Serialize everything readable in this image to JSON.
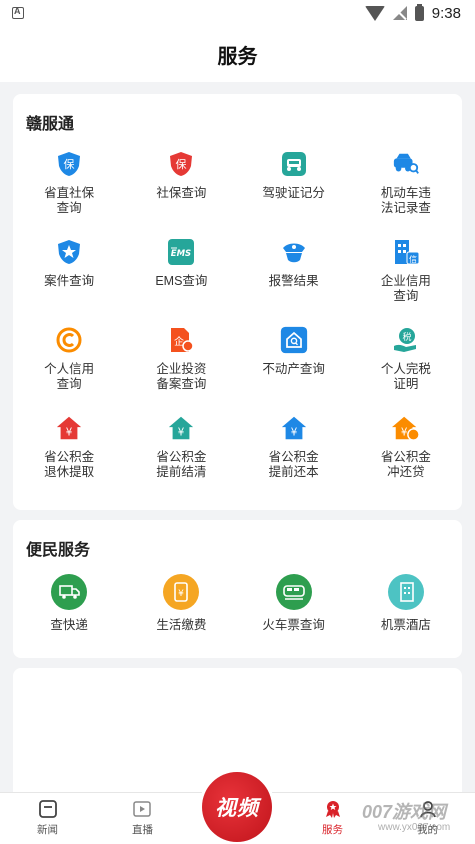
{
  "status_bar": {
    "time": "9:38"
  },
  "header": {
    "title": "服务"
  },
  "section1": {
    "title": "赣服通",
    "items": [
      {
        "label": "省直社保\n查询",
        "icon": "shield-bao-icon",
        "color": "#1e88e5"
      },
      {
        "label": "社保查询",
        "icon": "shield-bao-red-icon",
        "color": "#e53935"
      },
      {
        "label": "驾驶证记分",
        "icon": "car-license-icon",
        "color": "#26a69a"
      },
      {
        "label": "机动车违\n法记录查",
        "icon": "car-search-icon",
        "color": "#1e88e5"
      },
      {
        "label": "案件查询",
        "icon": "police-badge-icon",
        "color": "#1e88e5"
      },
      {
        "label": "EMS查询",
        "icon": "ems-icon",
        "color": "#26a69a"
      },
      {
        "label": "报警结果",
        "icon": "police-cap-icon",
        "color": "#1e88e5"
      },
      {
        "label": "企业信用\n查询",
        "icon": "building-credit-icon",
        "color": "#1e88e5"
      },
      {
        "label": "个人信用\n查询",
        "icon": "credit-c-icon",
        "color": "#fb8c00"
      },
      {
        "label": "企业投资\n备案查询",
        "icon": "invest-doc-icon",
        "color": "#f4511e"
      },
      {
        "label": "不动产查询",
        "icon": "house-search-icon",
        "color": "#1e88e5"
      },
      {
        "label": "个人完税\n证明",
        "icon": "tax-hand-icon",
        "color": "#26a69a"
      },
      {
        "label": "省公积金\n退休提取",
        "icon": "house-yuan-red-icon",
        "color": "#e53935"
      },
      {
        "label": "省公积金\n提前结清",
        "icon": "house-yuan-green-icon",
        "color": "#26a69a"
      },
      {
        "label": "省公积金\n提前还本",
        "icon": "house-yuan-blue-icon",
        "color": "#1e88e5"
      },
      {
        "label": "省公积金\n冲还贷",
        "icon": "house-yuan-orange-icon",
        "color": "#fb8c00"
      }
    ]
  },
  "section2": {
    "title": "便民服务",
    "items": [
      {
        "label": "查快递",
        "icon": "delivery-truck-icon",
        "color": "#2e9e4f"
      },
      {
        "label": "生活缴费",
        "icon": "phone-yuan-icon",
        "color": "#f5a623"
      },
      {
        "label": "火车票查询",
        "icon": "train-icon",
        "color": "#2e9e4f"
      },
      {
        "label": "机票酒店",
        "icon": "hotel-building-icon",
        "color": "#4dc3c3"
      }
    ]
  },
  "tabbar": {
    "tabs": [
      {
        "label": "新闻",
        "icon": "news-icon"
      },
      {
        "label": "直播",
        "icon": "live-video-icon"
      },
      {
        "label": "视频",
        "icon": "video-center-icon"
      },
      {
        "label": "服务",
        "icon": "service-medal-icon",
        "active": true
      },
      {
        "label": "我的",
        "icon": "profile-icon"
      }
    ]
  },
  "watermark": {
    "line1": "007游戏网",
    "line2": "www.yx007.com"
  }
}
